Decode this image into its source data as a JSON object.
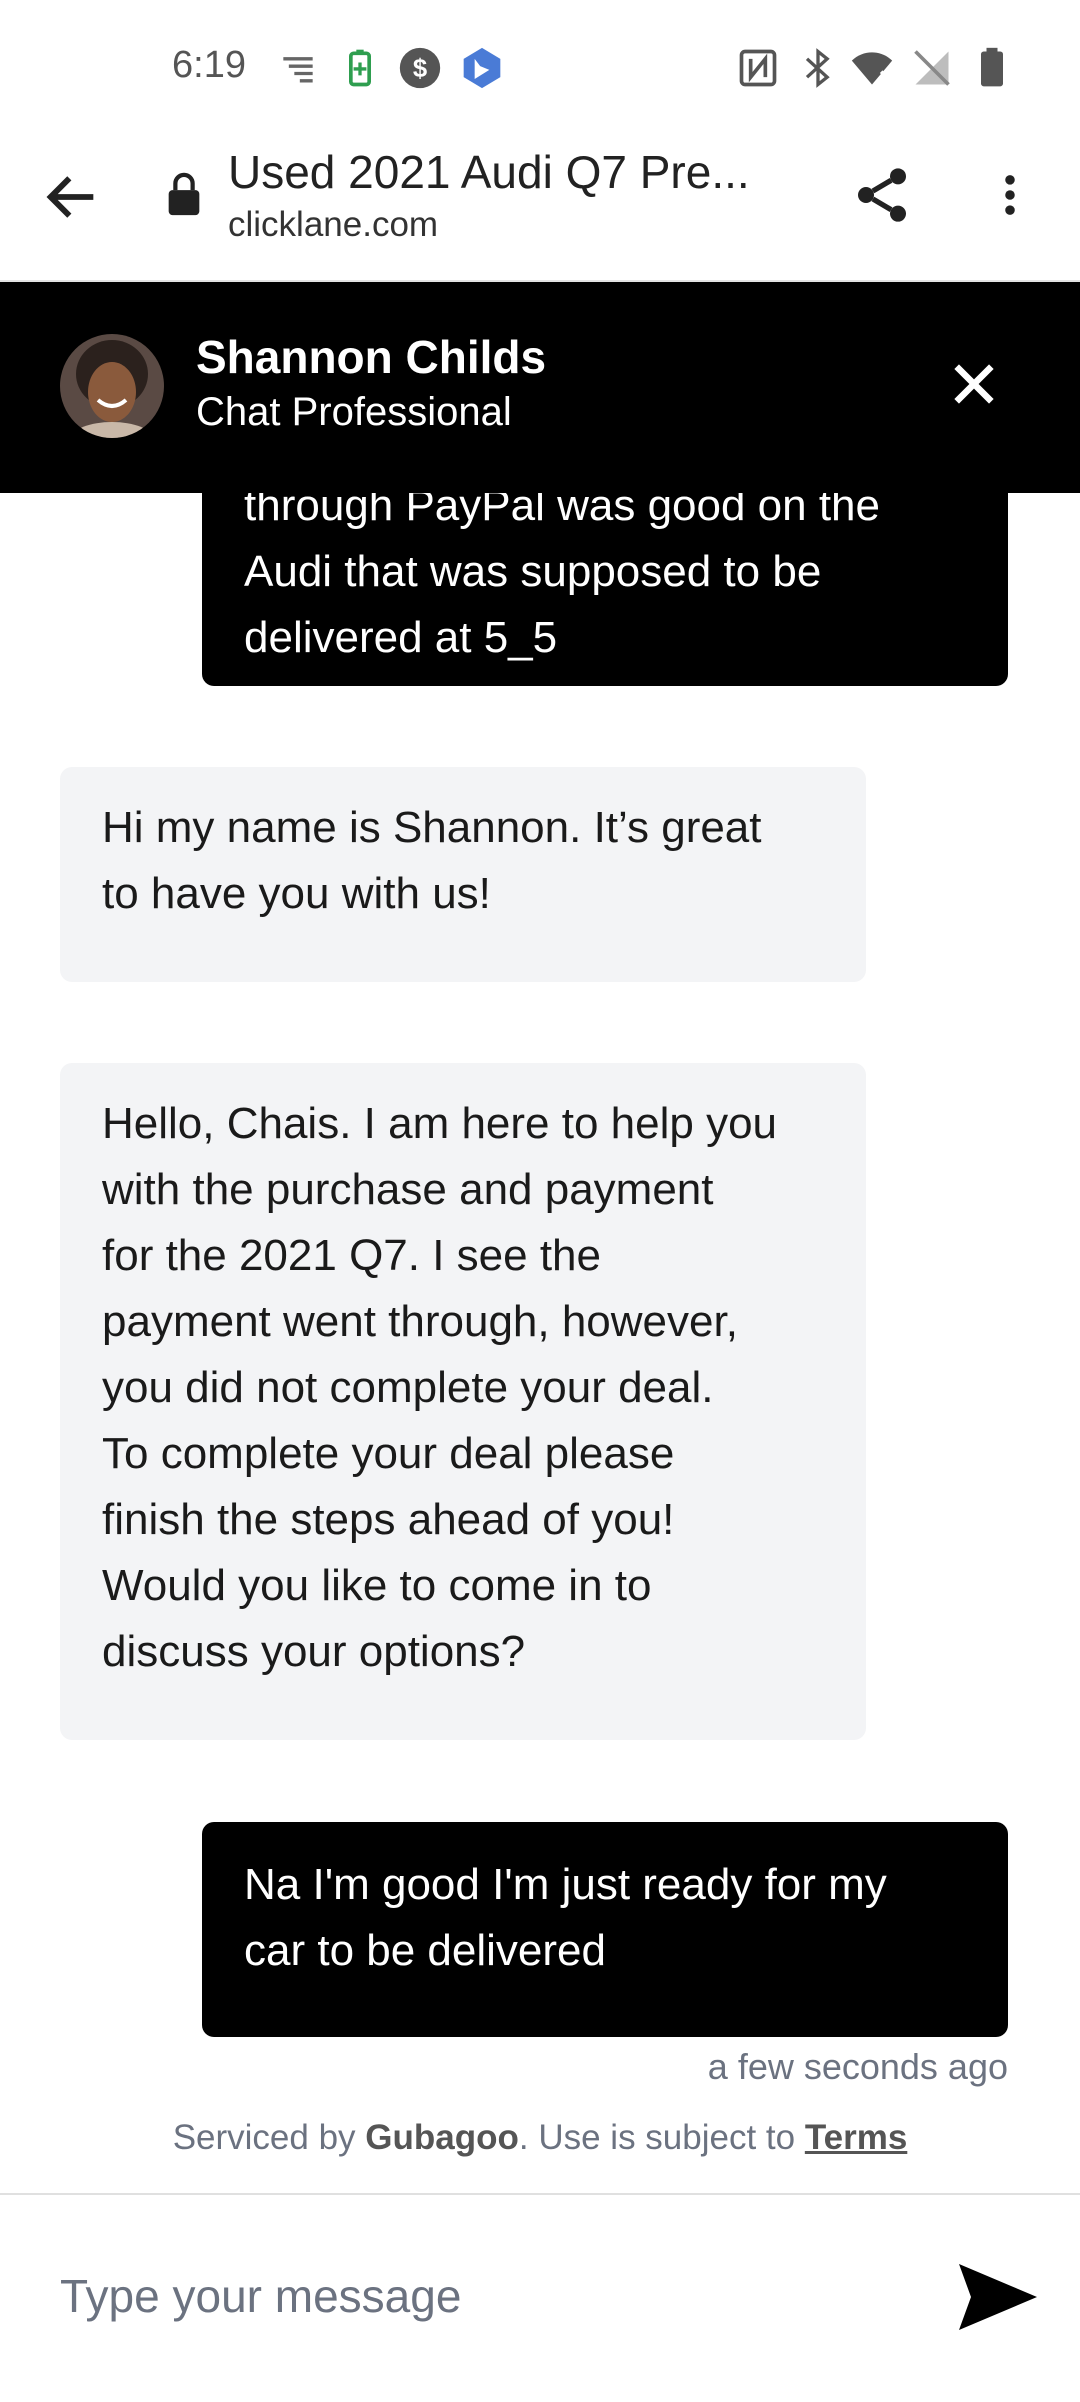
{
  "status_bar": {
    "time": "6:19",
    "icons_left": [
      "sort-lines-icon",
      "battery-saver-icon",
      "dollar-circle-icon",
      "bing-icon"
    ],
    "icons_right": [
      "nfc-icon",
      "bluetooth-icon",
      "wifi-icon",
      "no-signal-icon",
      "battery-icon"
    ]
  },
  "browser": {
    "page_title": "Used 2021 Audi Q7 Pre...",
    "url": "clicklane.com"
  },
  "chat_header": {
    "agent_name": "Shannon Childs",
    "agent_role": "Chat Professional"
  },
  "messages": [
    {
      "sender": "user",
      "text": "through PayPal was good on the\nAudi that was supposed to be\ndelivered at 5_5"
    },
    {
      "sender": "agent",
      "text": "Hi my name is Shannon. It’s great\nto have you with us!"
    },
    {
      "sender": "agent",
      "text": "Hello, Chais. I am here to help you\nwith the purchase and payment\nfor the 2021 Q7. I see the\npayment went through, however,\nyou did not complete your deal.\nTo complete your deal please\nfinish the steps ahead of you!\nWould you like to come in to\ndiscuss your options?"
    },
    {
      "sender": "user",
      "text": "Na I'm good I'm just ready for my\ncar to be delivered"
    }
  ],
  "last_timestamp": "a few seconds ago",
  "footer": {
    "prefix": "Serviced by ",
    "brand": "Gubagoo",
    "middle": ". Use is subject to ",
    "terms_label": "Terms"
  },
  "composer": {
    "placeholder": "Type your message"
  },
  "colors": {
    "header_bg": "#000000",
    "user_bubble": "#000000",
    "agent_bubble": "#f3f4f6",
    "muted_text": "#6b7280"
  }
}
